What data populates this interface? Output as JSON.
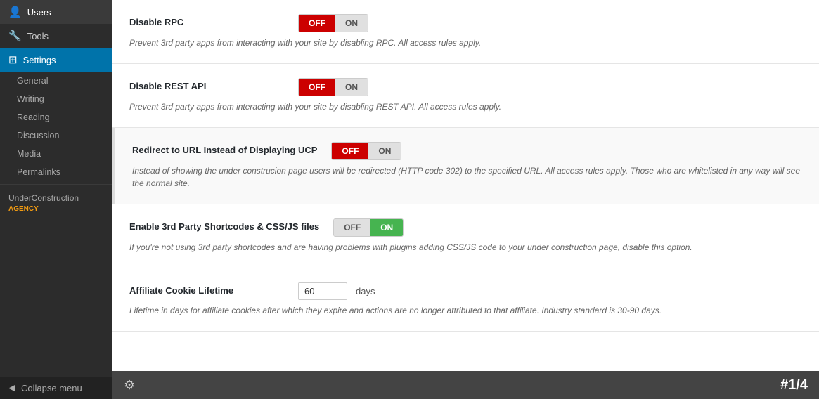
{
  "sidebar": {
    "nav_items": [
      {
        "id": "users",
        "label": "Users",
        "icon": "👤",
        "active": false
      },
      {
        "id": "tools",
        "label": "Tools",
        "icon": "🔧",
        "active": false
      },
      {
        "id": "settings",
        "label": "Settings",
        "icon": "⊞",
        "active": true
      }
    ],
    "sub_items": [
      {
        "id": "general",
        "label": "General",
        "active": false
      },
      {
        "id": "writing",
        "label": "Writing",
        "active": false
      },
      {
        "id": "reading",
        "label": "Reading",
        "active": false
      },
      {
        "id": "discussion",
        "label": "Discussion",
        "active": false
      },
      {
        "id": "media",
        "label": "Media",
        "active": false
      },
      {
        "id": "permalinks",
        "label": "Permalinks",
        "active": false
      }
    ],
    "plugin_item": {
      "label": "UnderConstruction",
      "badge": "AGENCY"
    },
    "collapse_label": "Collapse menu"
  },
  "settings": [
    {
      "id": "disable-rpc",
      "label": "Disable RPC",
      "toggle_state": "off",
      "description": "Prevent 3rd party apps from interacting with your site by disabling RPC. All access rules apply.",
      "highlighted": false
    },
    {
      "id": "disable-rest-api",
      "label": "Disable REST API",
      "toggle_state": "off",
      "description": "Prevent 3rd party apps from interacting with your site by disabling REST API. All access rules apply.",
      "highlighted": false
    },
    {
      "id": "redirect-url",
      "label": "Redirect to URL Instead of Displaying UCP",
      "toggle_state": "off",
      "description": "Instead of showing the under construcion page users will be redirected (HTTP code 302) to the specified URL. All access rules apply. Those who are whitelisted in any way will see the normal site.",
      "highlighted": true
    },
    {
      "id": "enable-shortcodes",
      "label": "Enable 3rd Party Shortcodes & CSS/JS files",
      "toggle_state": "on",
      "description": "If you're not using 3rd party shortcodes and are having problems with plugins adding CSS/JS code to your under construction page, disable this option.",
      "highlighted": false
    },
    {
      "id": "affiliate-cookie",
      "label": "Affiliate Cookie Lifetime",
      "type": "input",
      "input_value": "60",
      "input_suffix": "days",
      "description": "Lifetime in days for affiliate cookies after which they expire and actions are no longer attributed to that affiliate. Industry standard is 30-90 days.",
      "highlighted": false
    }
  ],
  "footer": {
    "pagination": "#1/4",
    "icon": "⚙"
  },
  "labels": {
    "off": "OFF",
    "on": "ON"
  }
}
